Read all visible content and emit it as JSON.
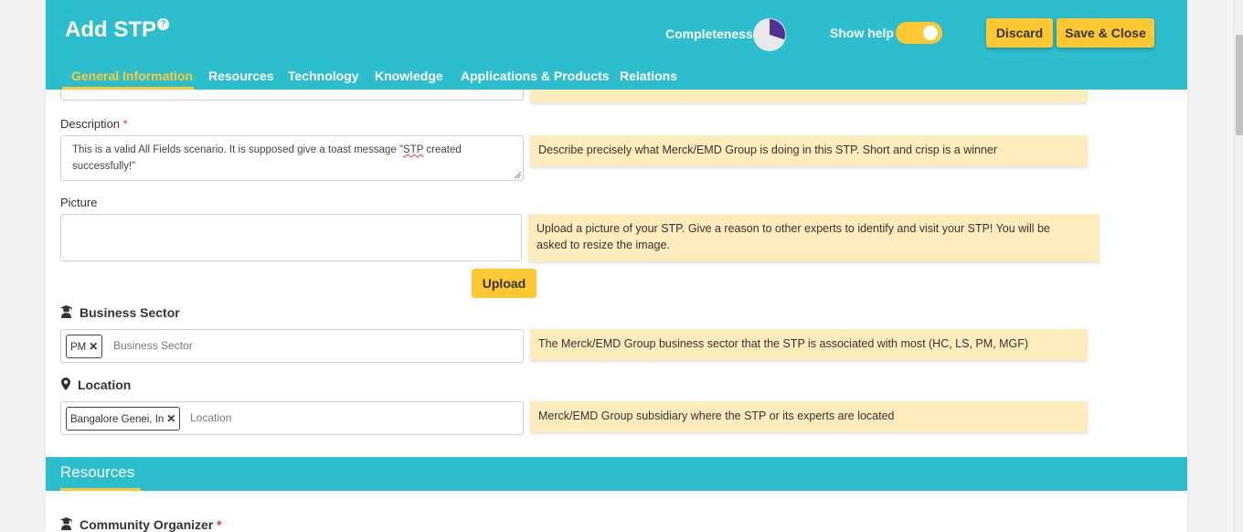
{
  "header": {
    "title": "Add STP",
    "completeness_label": "Completeness",
    "completeness_fraction": 0.3,
    "show_help_label": "Show help",
    "show_help_on": true,
    "discard_label": "Discard",
    "save_close_label": "Save & Close"
  },
  "tabs": [
    {
      "label": "General Information",
      "active": true
    },
    {
      "label": "Resources",
      "active": false
    },
    {
      "label": "Technology",
      "active": false
    },
    {
      "label": "Knowledge",
      "active": false
    },
    {
      "label": "Applications & Products",
      "active": false
    },
    {
      "label": "Relations",
      "active": false
    }
  ],
  "form": {
    "description": {
      "label": "Description",
      "required": "*",
      "value_line1": "This is a valid All Fields scenario. It is supposed give a toast message \"",
      "value_misspelled": "STP",
      "value_line1_end": " created",
      "value_line2": "successfully!\"",
      "hint": "Describe precisely what Merck/EMD Group is doing in this STP. Short and crisp is a winner"
    },
    "picture": {
      "label": "Picture",
      "hint_line1": "Upload a picture of your STP. Give a reason to other experts to identify and visit your STP! You will be",
      "hint_line2": "asked to resize the image.",
      "upload_label": "Upload"
    },
    "business_sector": {
      "label": "Business Sector",
      "chip": "PM",
      "placeholder": "Business Sector",
      "hint": "The Merck/EMD Group business sector that the STP is associated with most (HC, LS, PM, MGF)"
    },
    "location": {
      "label": "Location",
      "chip": "Bangalore Genei, In",
      "placeholder": "Location",
      "hint": "Merck/EMD Group subsidiary where the STP or its experts are located"
    }
  },
  "resources_section": {
    "title": "Resources",
    "community_organizer_label": "Community Organizer",
    "required": "*"
  },
  "colors": {
    "brand_teal": "#2dbecd",
    "accent_yellow": "#ffc832",
    "hint_background": "#ffecbc",
    "pie_fill": "#503291"
  },
  "icons": {
    "help": "question-circle-icon",
    "chip_remove": "close-icon",
    "business_sector": "user-graduate-icon",
    "location": "map-marker-icon"
  }
}
